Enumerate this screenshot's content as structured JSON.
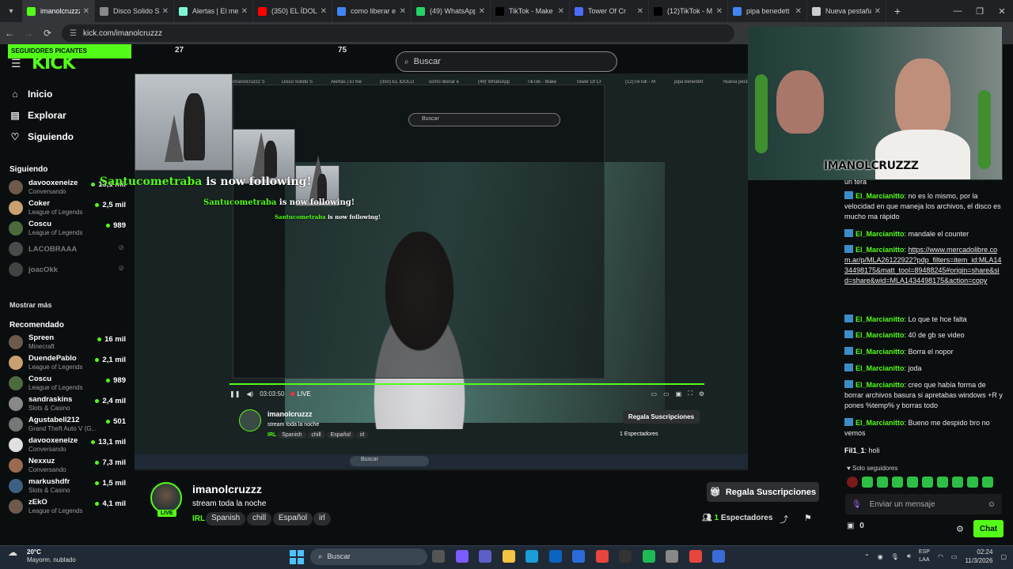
{
  "browser": {
    "tabs": [
      {
        "label": "imanolcruzzz S",
        "icon": "kick-icon",
        "color": "#53fc18",
        "active": true
      },
      {
        "label": "Disco Solido S",
        "icon": "page-icon",
        "color": "#888888"
      },
      {
        "label": "Alertas | El me",
        "icon": "streamlabs-icon",
        "color": "#80f5d2"
      },
      {
        "label": "(350) EL ÍDOLO",
        "icon": "youtube-icon",
        "color": "#ff0000"
      },
      {
        "label": "como liberar e",
        "icon": "google-icon",
        "color": "#4285f4"
      },
      {
        "label": "(49) WhatsApp",
        "icon": "whatsapp-icon",
        "color": "#25d366"
      },
      {
        "label": "TikTok - Make",
        "icon": "tiktok-icon",
        "color": "#000000"
      },
      {
        "label": "Tower Of Cr",
        "icon": "tower-icon",
        "color": "#4a6cf7"
      },
      {
        "label": "(12)TikTok - M",
        "icon": "tiktok-icon",
        "color": "#000000"
      },
      {
        "label": "pipa benedett",
        "icon": "google-icon",
        "color": "#4285f4"
      },
      {
        "label": "Nueva pestaña",
        "icon": "chrome-icon",
        "color": "#cccccc"
      }
    ],
    "url": "kick.com/imanolcruzzz"
  },
  "sidebar": {
    "banner": "SEGUIDORES PICANTES",
    "logo": "KICK",
    "nav": [
      {
        "label": "Inicio",
        "icon": "home-icon"
      },
      {
        "label": "Explorar",
        "icon": "browse-icon"
      },
      {
        "label": "Siguiendo",
        "icon": "heart-icon"
      }
    ],
    "following_title": "Siguiendo",
    "following": [
      {
        "name": "davooxeneize",
        "game": "Conversando",
        "viewers": "13,1 mil"
      },
      {
        "name": "Coker",
        "game": "League of Legends",
        "viewers": "2,5 mil"
      },
      {
        "name": "Coscu",
        "game": "League of Legends",
        "viewers": "989"
      },
      {
        "name": "LACOBRAAA",
        "game": "",
        "viewers": ""
      },
      {
        "name": "joacOkk",
        "game": "",
        "viewers": ""
      }
    ],
    "show_more": "Mostrar más",
    "recommended_title": "Recomendado",
    "recommended": [
      {
        "name": "Spreen",
        "game": "Minecraft",
        "viewers": "16 mil"
      },
      {
        "name": "DuendePablo",
        "game": "League of Legends",
        "viewers": "2,1 mil"
      },
      {
        "name": "Coscu",
        "game": "League of Legends",
        "viewers": "989"
      },
      {
        "name": "sandraskins",
        "game": "Slots & Casino",
        "viewers": "2,4 mil"
      },
      {
        "name": "Agustabell212",
        "game": "Grand Theft Auto V (G...",
        "viewers": "501"
      },
      {
        "name": "davooxeneize",
        "game": "Conversando",
        "viewers": "13,1 mil"
      },
      {
        "name": "Nexxuz",
        "game": "Conversando",
        "viewers": "7,3 mil"
      },
      {
        "name": "markushdfr",
        "game": "Slots & Casino",
        "viewers": "1,5 mil"
      },
      {
        "name": "zEkO",
        "game": "League of Legends",
        "viewers": "4,1 mil"
      }
    ]
  },
  "top_numbers": [
    "27",
    "75"
  ],
  "search": {
    "placeholder": "Buscar"
  },
  "video": {
    "follow_user": "Santucometraba",
    "follow_text": "is now following!",
    "time": "03:03:50",
    "live_label": "LIVE",
    "inner_search": "Buscar"
  },
  "webcam": {
    "overlay_name": "IMANOLCRUZZZ"
  },
  "stream": {
    "name": "imanolcruzzz",
    "title": "stream toda la noche",
    "category": "IRL",
    "tags": [
      "Spanish",
      "chill",
      "Español",
      "irl"
    ],
    "live_badge": "LIVE",
    "subscribe": "Regala Suscripciones",
    "viewers_count": "1",
    "viewers_label": "Espectadores"
  },
  "chat": {
    "messages": [
      {
        "user": "",
        "text": "un tera"
      },
      {
        "user": "El_Marcianitto",
        "text": "no es lo mismo, por la velocidad en que maneja los archivos, el disco es mucho ma rápido"
      },
      {
        "user": "El_Marcianitto",
        "text": "mandale el counter"
      },
      {
        "user": "El_Marcianitto",
        "text": "",
        "link": "https://www.mercadolibre.com.ar/p/MLA26122922?pdp_filters=item_id:MLA1434498175&matt_tool=89488245#origin=share&sid=share&wid=MLA1434498175&action=copy"
      },
      {
        "user": "El_Marcianitto",
        "text": "Lo que te hce falta"
      },
      {
        "user": "El_Marcianitto",
        "text": "40 de gb se video"
      },
      {
        "user": "El_Marcianitto",
        "text": "Borra el nopor"
      },
      {
        "user": "El_Marcianitto",
        "text": "joda"
      },
      {
        "user": "El_Marcianitto",
        "text": "creo que había forma de borrar archivos basura si apretabas windows +R y pones %temp% y borras todo"
      },
      {
        "user": "El_Marcianitto",
        "text": "Bueno me despido bro no vemos"
      },
      {
        "user": "Fil1_1",
        "text": "holi"
      }
    ],
    "followers_only": "Solo seguidores",
    "input_placeholder": "Enviar un mensaje",
    "points": "0",
    "send_label": "Chat"
  },
  "taskbar": {
    "temp": "20°C",
    "weather": "Mayorm. nublado",
    "search": "Buscar",
    "lang1": "ESP",
    "lang2": "LAA",
    "time": "02:24",
    "date": "11/3/2026"
  },
  "colors": {
    "kick_green": "#53fc18",
    "bg": "#0b0e0f"
  }
}
